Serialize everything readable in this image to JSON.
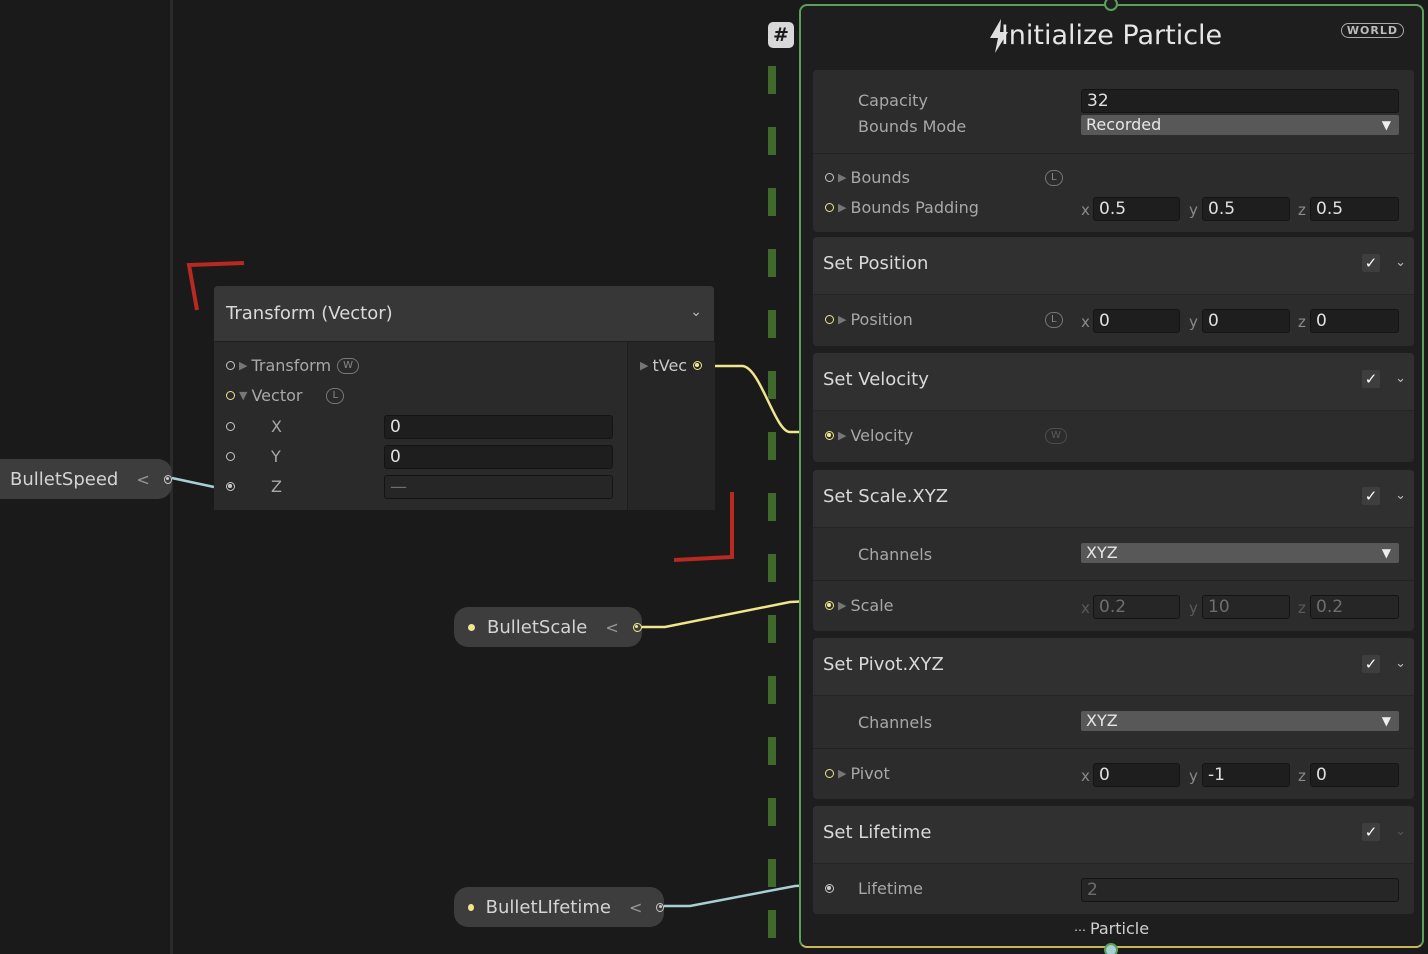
{
  "params": {
    "bullet_speed": "BulletSpeed",
    "bullet_scale": "BulletScale",
    "bullet_lifetime": "BulletLIfetime"
  },
  "transform_node": {
    "title": "Transform (Vector)",
    "transform_label": "Transform",
    "transform_badge": "W",
    "vector_label": "Vector",
    "vector_badge": "L",
    "x_label": "X",
    "y_label": "Y",
    "z_label": "Z",
    "x_value": "0",
    "y_value": "0",
    "z_value": "—",
    "output_label": "tVec"
  },
  "init": {
    "hash": "#",
    "title": "Initialize Particle",
    "space_badge": "WORLD",
    "capacity_label": "Capacity",
    "capacity_value": "32",
    "bounds_mode_label": "Bounds Mode",
    "bounds_mode_value": "Recorded",
    "bounds_label": "Bounds",
    "bounds_badge": "L",
    "bounds_padding_label": "Bounds Padding",
    "bounds_padding": {
      "x": "0.5",
      "y": "0.5",
      "z": "0.5"
    },
    "axis_x": "x",
    "axis_y": "y",
    "axis_z": "z",
    "footer": "Particle"
  },
  "blocks": {
    "set_position": {
      "title": "Set Position",
      "attr": "Position",
      "badge": "L",
      "x": "0",
      "y": "0",
      "z": "0"
    },
    "set_velocity": {
      "title": "Set Velocity",
      "attr": "Velocity",
      "badge": "W"
    },
    "set_scale": {
      "title": "Set Scale.XYZ",
      "channels_label": "Channels",
      "channels": "XYZ",
      "attr": "Scale",
      "x": "0.2",
      "y": "10",
      "z": "0.2"
    },
    "set_pivot": {
      "title": "Set Pivot.XYZ",
      "channels_label": "Channels",
      "channels": "XYZ",
      "attr": "Pivot",
      "x": "0",
      "y": "-1",
      "z": "0"
    },
    "set_lifetime": {
      "title": "Set Lifetime",
      "attr": "Lifetime",
      "value": "2"
    }
  },
  "colors": {
    "context_border": "#5aa05a",
    "wire_float": "#f0e68c",
    "wire_value": "#a8cfd2",
    "selection": "#b8291f"
  },
  "icons": [
    "bolt-icon",
    "checkbox-icon",
    "chevron-down-icon",
    "dropdown-arrow-icon",
    "particle-icon",
    "port-icon"
  ]
}
